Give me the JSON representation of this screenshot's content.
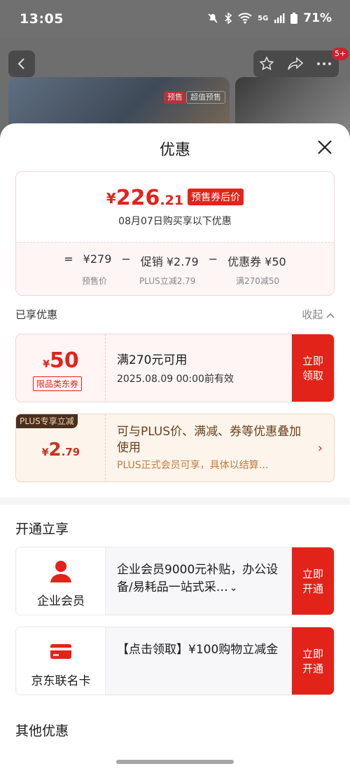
{
  "status_bar": {
    "time": "13:05",
    "network": "5G",
    "battery": "71%"
  },
  "background": {
    "badge": "5+",
    "tag_presale": "预售",
    "tag_super": "超值预售"
  },
  "sheet": {
    "title": "优惠",
    "price": {
      "yen": "¥",
      "integer": "226",
      "decimal": ".21",
      "tag": "预售券后价",
      "subtitle": "08月07日购买享以下优惠"
    },
    "formula": {
      "eq": "=",
      "pre_price": "¥279",
      "minus1": "−",
      "promo": "促销 ¥2.79",
      "minus2": "−",
      "coupon": "优惠券 ¥50",
      "cap_pre": "预售价",
      "cap_promo": "PLUS立减2.79",
      "cap_coupon": "满270减50"
    },
    "enjoyed": {
      "label": "已享优惠",
      "collapse": "收起"
    },
    "coupon": {
      "yen": "¥",
      "amount": "50",
      "category": "限品类东券",
      "condition": "满270元可用",
      "expire": "2025.08.09 00:00前有效",
      "button": "立即领取"
    },
    "plus": {
      "tag": "PLUS专享立减",
      "yen": "¥",
      "amount": "2",
      "decimal": ".79",
      "title": "可与PLUS价、满减、券等优惠叠加使用",
      "note": "PLUS正式会员可享，具体以结算…"
    },
    "open_section": {
      "title": "开通立享",
      "cards": [
        {
          "name": "企业会员",
          "desc": "企业会员9000元补贴，办公设备/易耗品一站式采…",
          "button": "立即开通",
          "icon": "person-icon",
          "chev": "⌄"
        },
        {
          "name": "京东联名卡",
          "desc": "【点击领取】¥100购物立减金",
          "button": "立即开通",
          "icon": "card-icon"
        }
      ]
    },
    "other_section": {
      "title": "其他优惠"
    }
  },
  "colors": {
    "accent": "#e2231a",
    "plus_bg": "#fdf5ec",
    "coupon_bg": "#fff5f5"
  }
}
